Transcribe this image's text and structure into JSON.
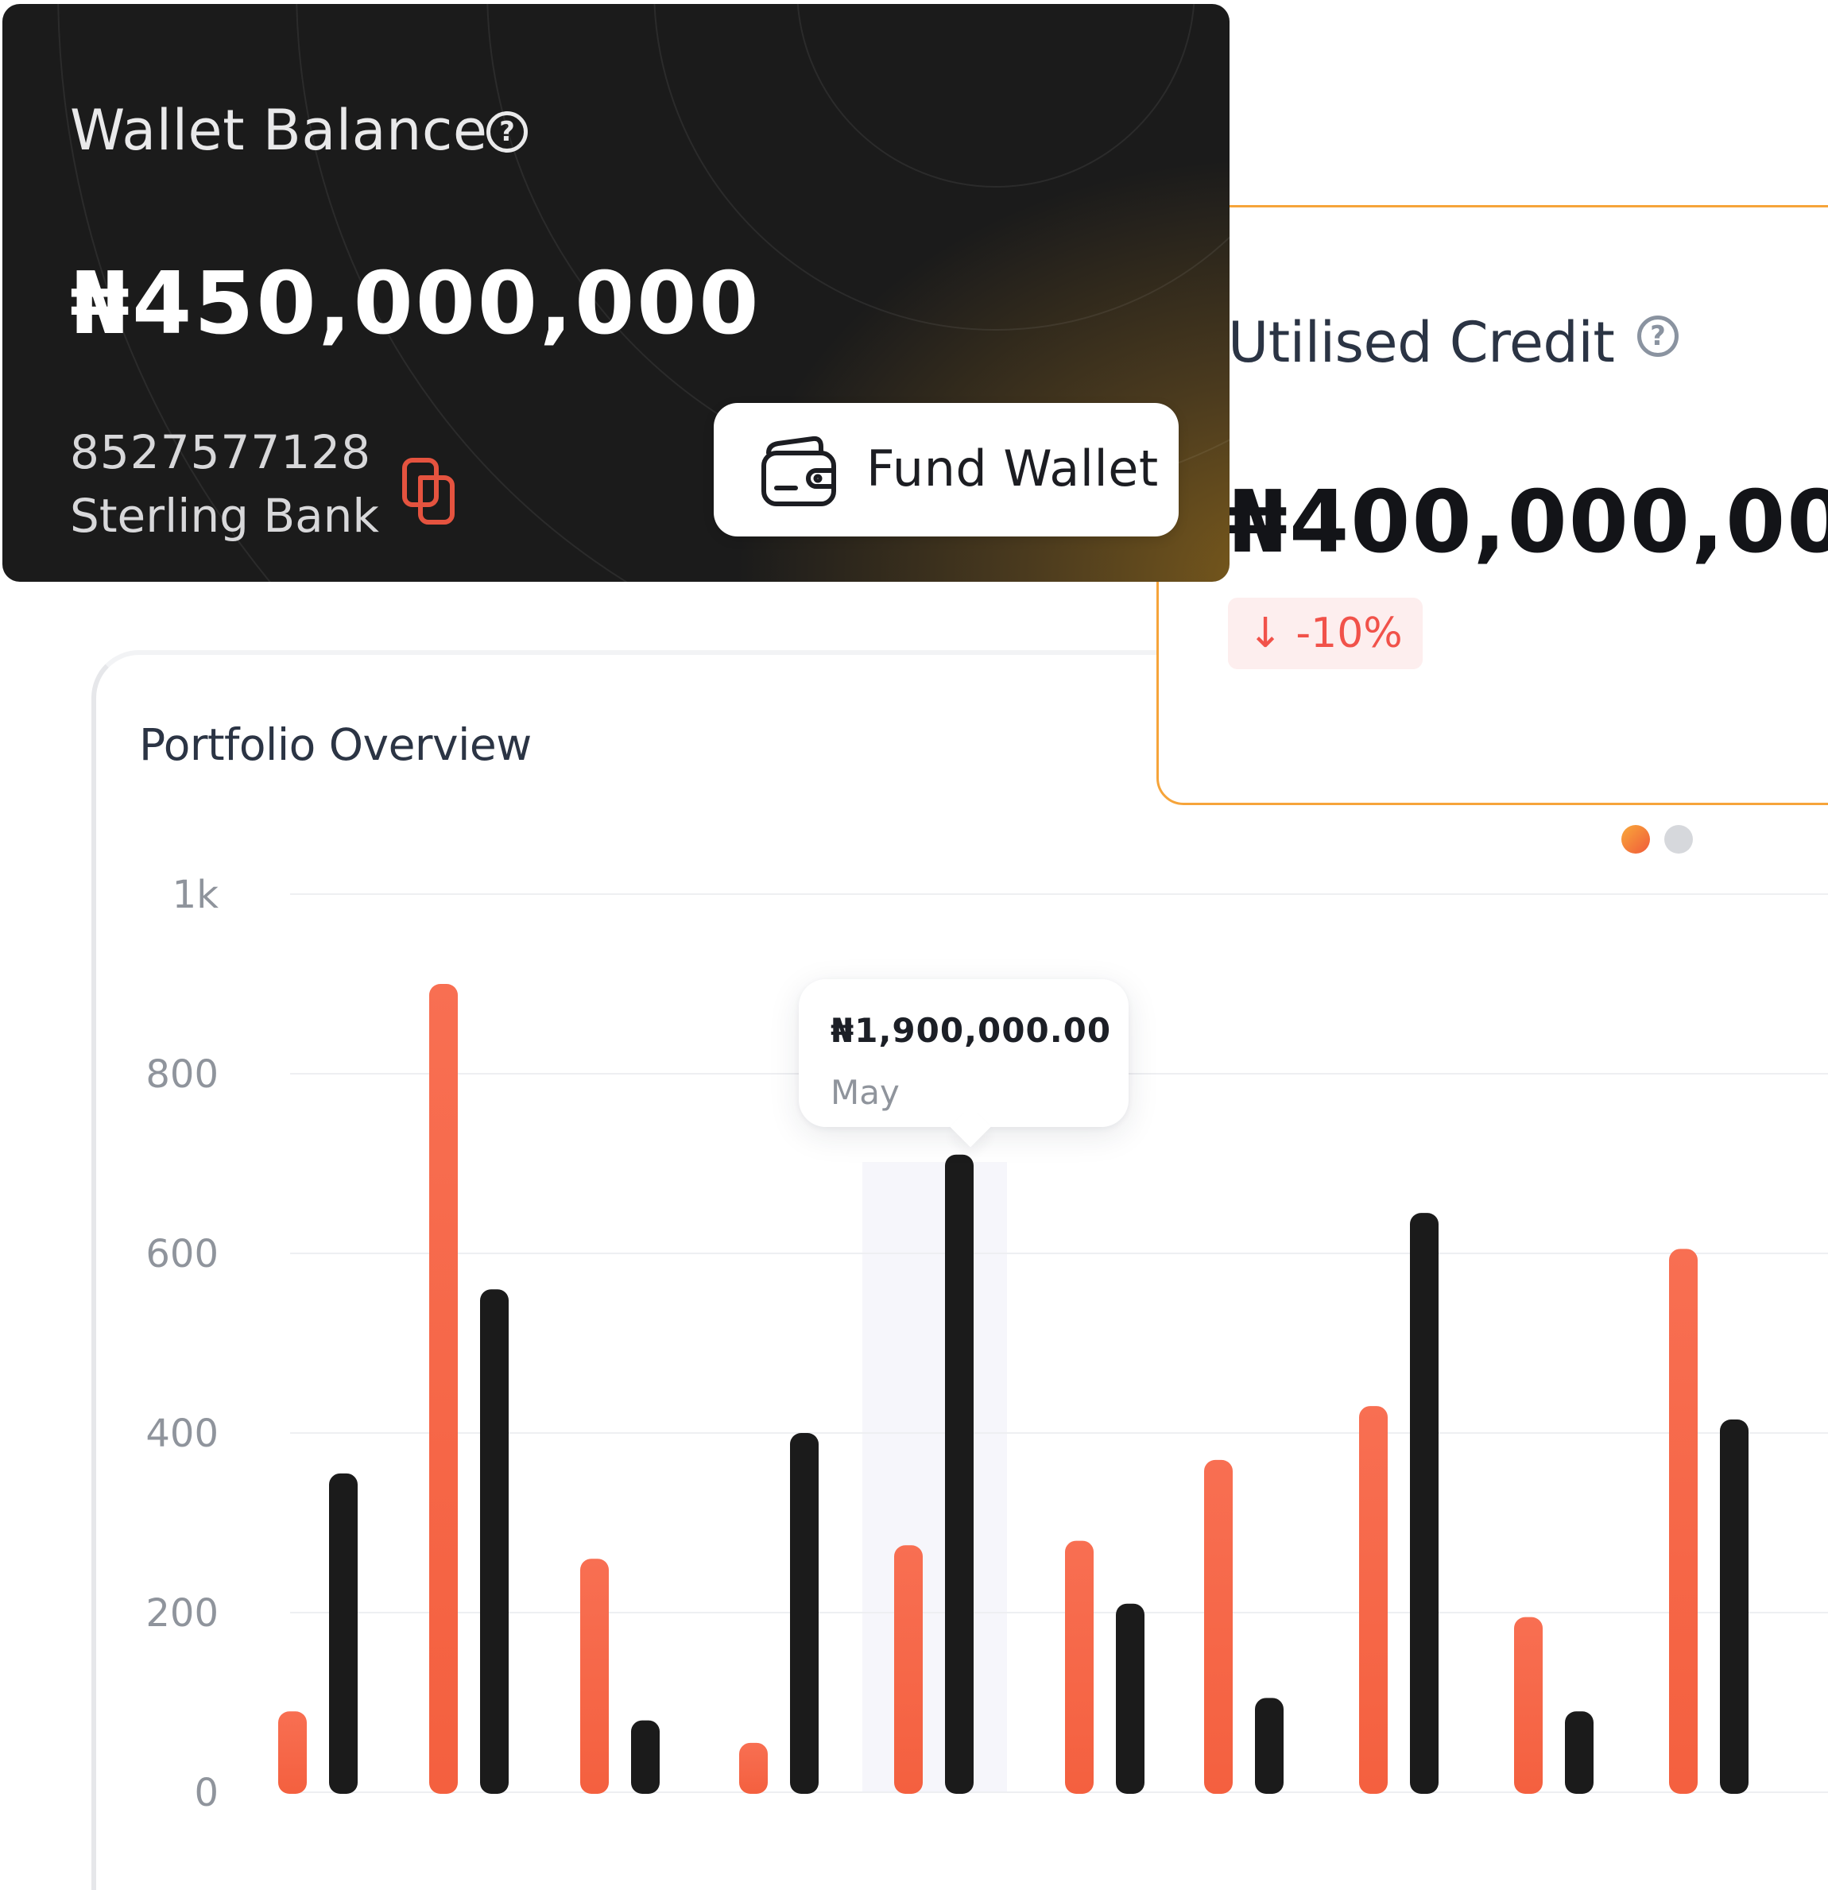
{
  "wallet": {
    "title": "Wallet Balance",
    "help_glyph": "?",
    "amount": "₦450,000,000",
    "account_number": "8527577128",
    "bank_name": "Sterling Bank",
    "copy_icon": "copy-icon",
    "fund_button_label": "Fund Wallet",
    "fund_button_icon": "wallet-icon"
  },
  "credit": {
    "title": "Utilised Credit",
    "help_glyph": "?",
    "amount": "₦400,000,00",
    "change": "↓ -10%",
    "change_color": "#f1524a",
    "accent_color": "#f6a43a"
  },
  "carousel": {
    "count": 2,
    "active_index": 0
  },
  "portfolio": {
    "title": "Portfolio Overview",
    "tooltip": {
      "amount": "₦1,900,000.00",
      "month": "May"
    }
  },
  "chart_data": {
    "type": "bar",
    "title": "Portfolio Overview",
    "y_ticks": [
      "1k",
      "800",
      "600",
      "400",
      "200",
      "0"
    ],
    "ylim": [
      0,
      1000
    ],
    "grid": true,
    "highlighted_group": 4,
    "series": [
      {
        "color": "#f86a4a",
        "values": [
          90,
          900,
          260,
          55,
          275,
          280,
          370,
          430,
          195,
          605
        ]
      },
      {
        "color": "#1b1b1b",
        "values": [
          355,
          560,
          80,
          400,
          710,
          210,
          105,
          645,
          90,
          415
        ]
      }
    ]
  }
}
